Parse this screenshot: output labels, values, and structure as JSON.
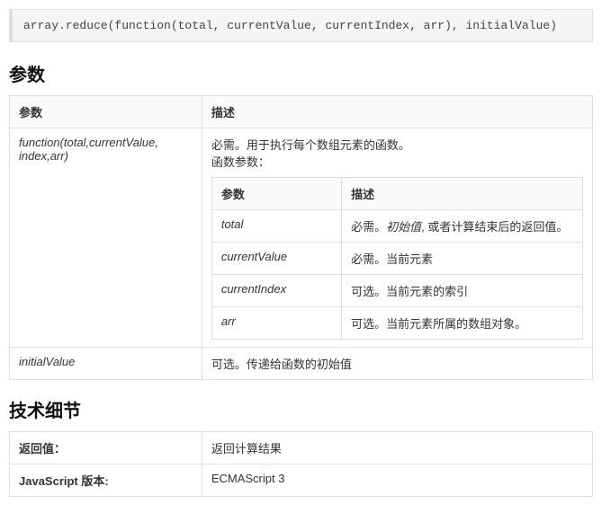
{
  "code": "array.reduce(function(total, currentValue, currentIndex, arr), initialValue)",
  "sections": {
    "params_heading": "参数",
    "tech_heading": "技术细节"
  },
  "params_table": {
    "header_param": "参数",
    "header_desc": "描述",
    "row_function": {
      "name": "function(total,currentValue, index,arr)",
      "desc_line1": "必需。用于执行每个数组元素的函数。",
      "desc_line2": "函数参数：",
      "nested_header_param": "参数",
      "nested_header_desc": "描述",
      "nested_rows": {
        "total": {
          "name": "total",
          "desc_prefix": "必需。",
          "desc_italic": "初始值",
          "desc_suffix": ", 或者计算结束后的返回值。"
        },
        "currentValue": {
          "name": "currentValue",
          "desc": "必需。当前元素"
        },
        "currentIndex": {
          "name": "currentIndex",
          "desc": "可选。当前元素的索引"
        },
        "arr": {
          "name": "arr",
          "desc": "可选。当前元素所属的数组对象。"
        }
      }
    },
    "row_initial": {
      "name": "initialValue",
      "desc": "可选。传递给函数的初始值"
    }
  },
  "tech_table": {
    "return_label": "返回值：",
    "return_value": "返回计算结果",
    "version_label": "JavaScript 版本:",
    "version_value": "ECMAScript 3"
  }
}
